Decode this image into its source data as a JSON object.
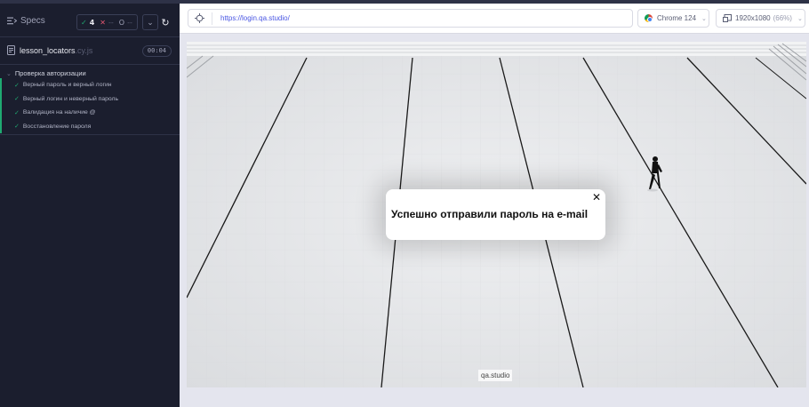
{
  "reporter": {
    "specs_label": "Specs",
    "stats": {
      "passed_icon": "✓",
      "passed": "4",
      "failed_icon": "✕",
      "failed": "--",
      "pending_icon": "O",
      "pending": "--"
    },
    "file": {
      "name": "lesson_locators",
      "ext": ".cy.js",
      "duration": "00:04"
    },
    "suite": {
      "title": "Проверка авторизации"
    },
    "tests": [
      {
        "label": "Верный пароль и верный логин"
      },
      {
        "label": "Верный логин и неверный пароль"
      },
      {
        "label": "Валидация на наличие @"
      },
      {
        "label": "Восстановление пароля"
      }
    ]
  },
  "topbar": {
    "url": "https://login.qa.studio/",
    "browser": "Chrome 124",
    "viewport": "1920x1080",
    "zoom": "(66%)"
  },
  "aut": {
    "modal_message": "Успешно отправили пароль на e-mail",
    "watermark": "qa.studio"
  },
  "colors": {
    "pass": "#1fa971",
    "fail": "#e45770",
    "url": "#4956e3",
    "panel": "#1b1e2e"
  }
}
